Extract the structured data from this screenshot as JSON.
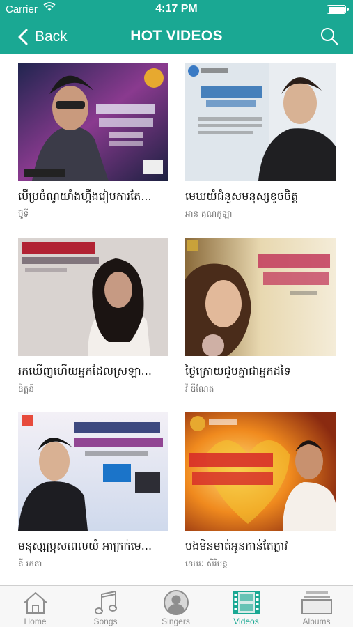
{
  "status_bar": {
    "carrier": "Carrier",
    "time": "4:17 PM"
  },
  "nav": {
    "back_label": "Back",
    "title": "HOT VIDEOS"
  },
  "videos": [
    {
      "title": "បើប្រចំណូយាំងហ្គឹងរៀបការតែ...",
      "artist": "ប៊ូទី"
    },
    {
      "title": "មេឃយំជំនួសមនុស្សខូចចិត្ត",
      "artist": "អាន គុណកូឡា"
    },
    {
      "title": "រកឃើញហើយអ្នកដែលស្រឡា...",
      "artist": "ឌិត្តន៍"
    },
    {
      "title": "ថ្ងៃក្រោយជួបគ្នាជាអ្នកដទៃ",
      "artist": "វី ឌីណែត"
    },
    {
      "title": "មនុស្សប្រុសពេលយំ អាក្រក់មេ...",
      "artist": "នី រតនា"
    },
    {
      "title": "បងមិនមាត់អូនកាន់តែភ្លាវ",
      "artist": "ខេមរៈ សិរីមន្ត"
    }
  ],
  "tabs": [
    {
      "label": "Home",
      "icon": "home-icon"
    },
    {
      "label": "Songs",
      "icon": "music-note-icon"
    },
    {
      "label": "Singers",
      "icon": "singer-icon"
    },
    {
      "label": "Videos",
      "icon": "film-icon"
    },
    {
      "label": "Albums",
      "icon": "albums-icon"
    }
  ],
  "active_tab": "Videos",
  "colors": {
    "accent": "#1aa893",
    "tab_inactive": "#8e8e8e"
  }
}
